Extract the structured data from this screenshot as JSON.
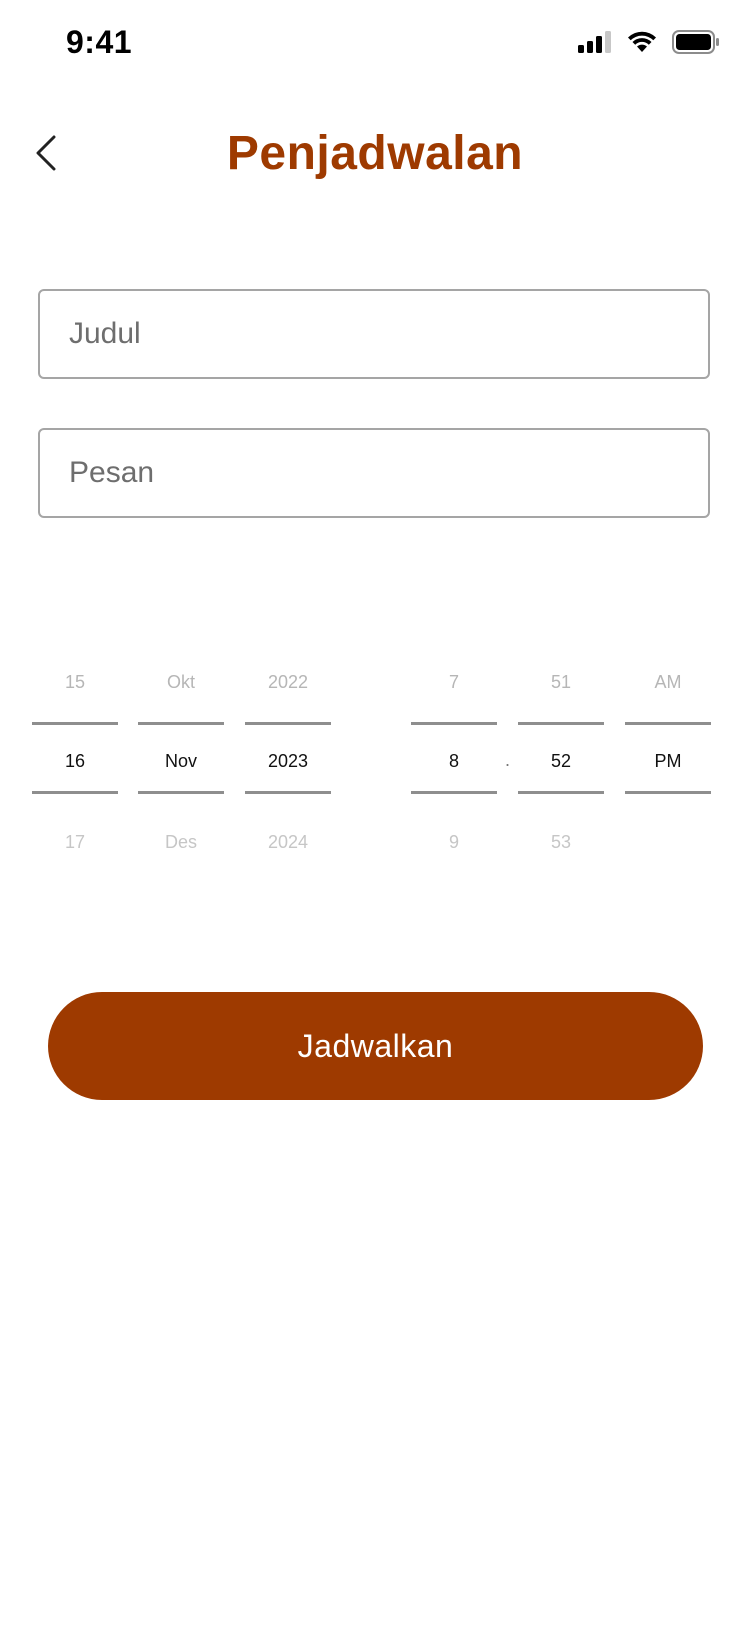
{
  "status_bar": {
    "time": "9:41",
    "icons": [
      "signal-icon",
      "wifi-icon",
      "battery-icon"
    ]
  },
  "header": {
    "back_icon": "chevron-left-icon",
    "title": "Penjadwalan"
  },
  "form": {
    "title_placeholder": "Judul",
    "message_placeholder": "Pesan"
  },
  "date_picker": {
    "day": {
      "prev": "15",
      "selected": "16",
      "next": "17"
    },
    "month": {
      "prev": "Okt",
      "selected": "Nov",
      "next": "Des"
    },
    "year": {
      "prev": "2022",
      "selected": "2023",
      "next": "2024"
    }
  },
  "time_picker": {
    "hour": {
      "prev": "7",
      "selected": "8",
      "next": "9"
    },
    "separator": ".",
    "minute": {
      "prev": "51",
      "selected": "52",
      "next": "53"
    },
    "period": {
      "prev": "AM",
      "selected": "PM",
      "next": ""
    }
  },
  "submit_label": "Jadwalkan",
  "colors": {
    "accent": "#9e3a00",
    "border": "#a5a5a5",
    "wheel_line": "#8e8e8e"
  }
}
